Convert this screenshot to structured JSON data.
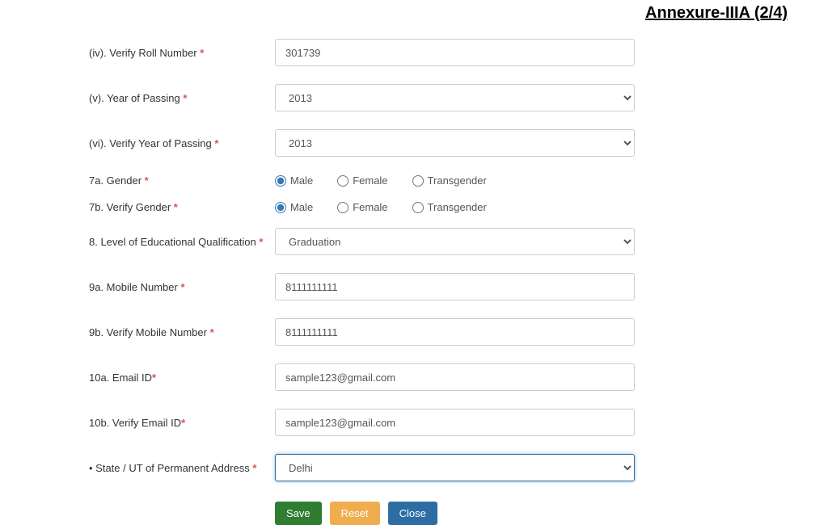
{
  "header": {
    "title": "Annexure-IIIA (2/4)"
  },
  "fields": {
    "verify_roll": {
      "label": "(iv). Verify Roll Number",
      "value": "301739"
    },
    "year_passing": {
      "label": "(v). Year of Passing",
      "value": "2013"
    },
    "verify_year_passing": {
      "label": "(vi). Verify Year of Passing",
      "value": "2013"
    },
    "gender": {
      "label": "7a. Gender",
      "options": {
        "male": "Male",
        "female": "Female",
        "transgender": "Transgender"
      }
    },
    "verify_gender": {
      "label": "7b. Verify Gender",
      "options": {
        "male": "Male",
        "female": "Female",
        "transgender": "Transgender"
      }
    },
    "education": {
      "label": "8. Level of Educational Qualification",
      "value": "Graduation"
    },
    "mobile": {
      "label": "9a. Mobile Number",
      "value": "8111111111"
    },
    "verify_mobile": {
      "label": "9b. Verify Mobile Number",
      "value": "8111111111"
    },
    "email": {
      "label": "10a. Email ID",
      "value": "sample123@gmail.com"
    },
    "verify_email": {
      "label": "10b. Verify Email ID",
      "value": "sample123@gmail.com"
    },
    "state": {
      "label": "• State / UT of Permanent Address",
      "value": "Delhi"
    }
  },
  "buttons": {
    "save": "Save",
    "reset": "Reset",
    "close": "Close"
  }
}
